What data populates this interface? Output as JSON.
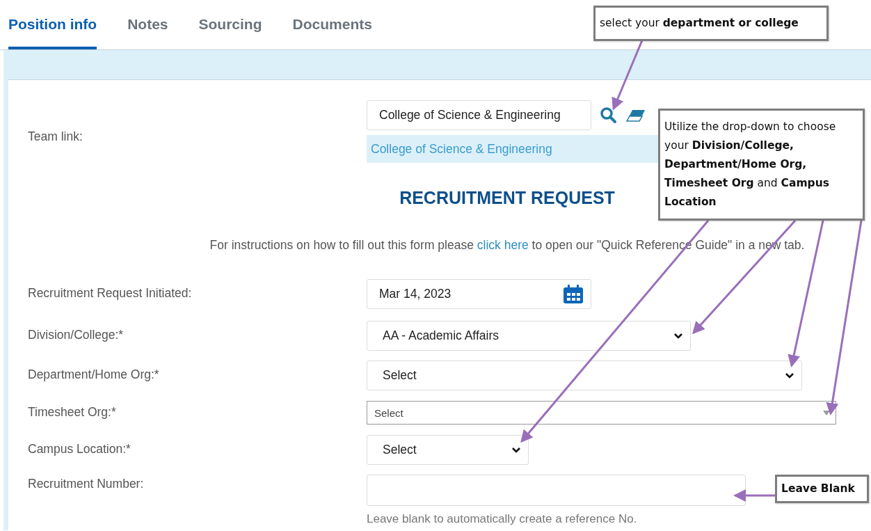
{
  "tabs": [
    {
      "label": "Position info",
      "selected": true
    },
    {
      "label": "Notes",
      "selected": false
    },
    {
      "label": "Sourcing",
      "selected": false
    },
    {
      "label": "Documents",
      "selected": false
    }
  ],
  "team_link": {
    "label": "Team link:",
    "value": "College of Science & Engineering",
    "suggestion": "College of Science & Engineering"
  },
  "title": "RECRUITMENT REQUEST",
  "instructions": {
    "before": "For instructions on how to fill out this form please",
    "link": "click here",
    "after": "to open our \"Quick Reference Guide\" in a new tab."
  },
  "fields": [
    {
      "kind": "date",
      "label": "Recruitment Request Initiated:",
      "value": "Mar 14, 2023"
    },
    {
      "kind": "select",
      "label": "Division/College:*",
      "value": "AA - Academic Affairs"
    },
    {
      "kind": "select",
      "label": "Department/Home Org:*",
      "value": "Select"
    },
    {
      "kind": "combo",
      "label": "Timesheet Org:*",
      "value": "Select"
    },
    {
      "kind": "select",
      "label": "Campus Location:*",
      "value": "Select"
    },
    {
      "kind": "text",
      "label": "Recruitment Number:",
      "hint": "Leave blank to automatically create a reference No."
    }
  ],
  "callouts": [
    {
      "text": "select your **department or college**",
      "bold": false
    },
    {
      "text": "Utilize the drop-down to choose your **Division/College, Department/Home Org, Timesheet Org** and **Campus Location**",
      "bold": false
    },
    {
      "text": "Leave Blank",
      "bold": true
    }
  ]
}
